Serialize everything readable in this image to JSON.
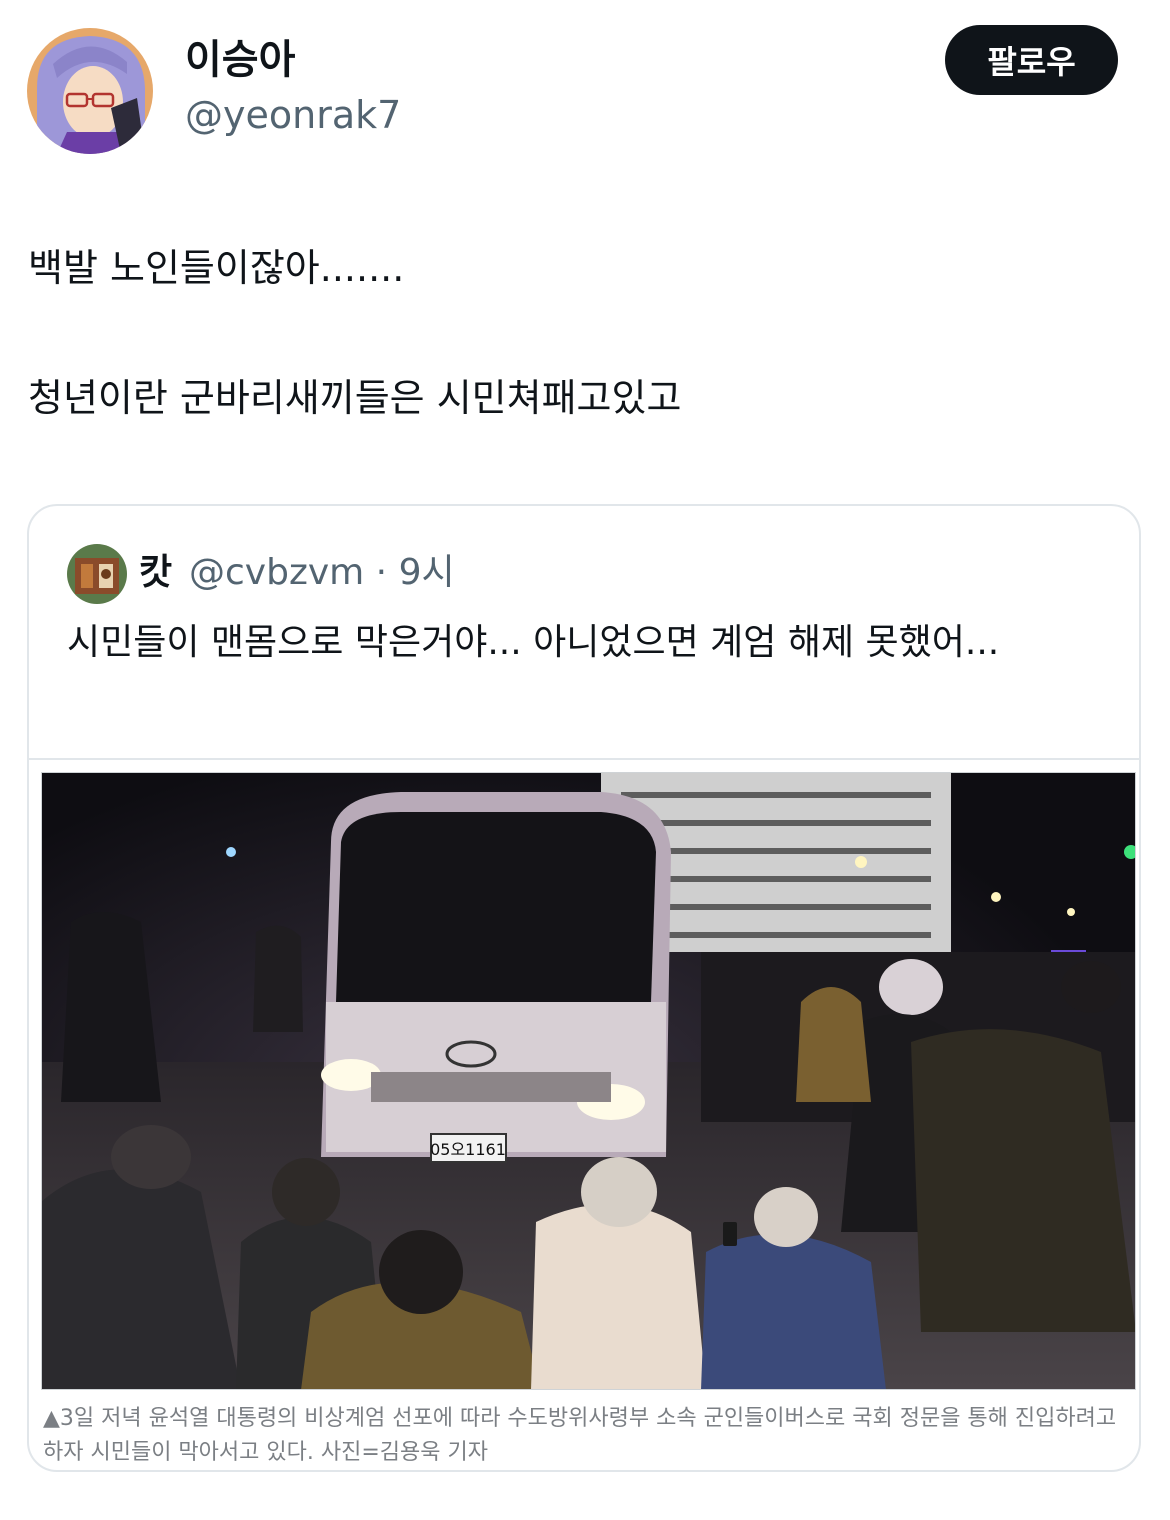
{
  "author": {
    "name": "이승아",
    "handle": "@yeonrak7",
    "avatar_icon": "anime-avatar-icon"
  },
  "follow_label": "팔로우",
  "tweet_lines": [
    "백발 노인들이잖아.......",
    "청년이란 군바리새끼들은 시민쳐패고있고"
  ],
  "quote": {
    "name": "캇",
    "handle": "@cvbzvm",
    "time": "9시",
    "separator": "·",
    "text": "시민들이 맨몸으로 막은거야... 아니었으면 계엄 해제 못했어...",
    "photo": {
      "plate": "05오1161",
      "caption": "▲3일 저녁 윤석열 대통령의 비상계엄 선포에 따라 수도방위사령부 소속 군인들이버스로 국회 정문을 통해 진입하려고 하자 시민들이 막아서고 있다. 사진=김용욱 기자"
    }
  }
}
